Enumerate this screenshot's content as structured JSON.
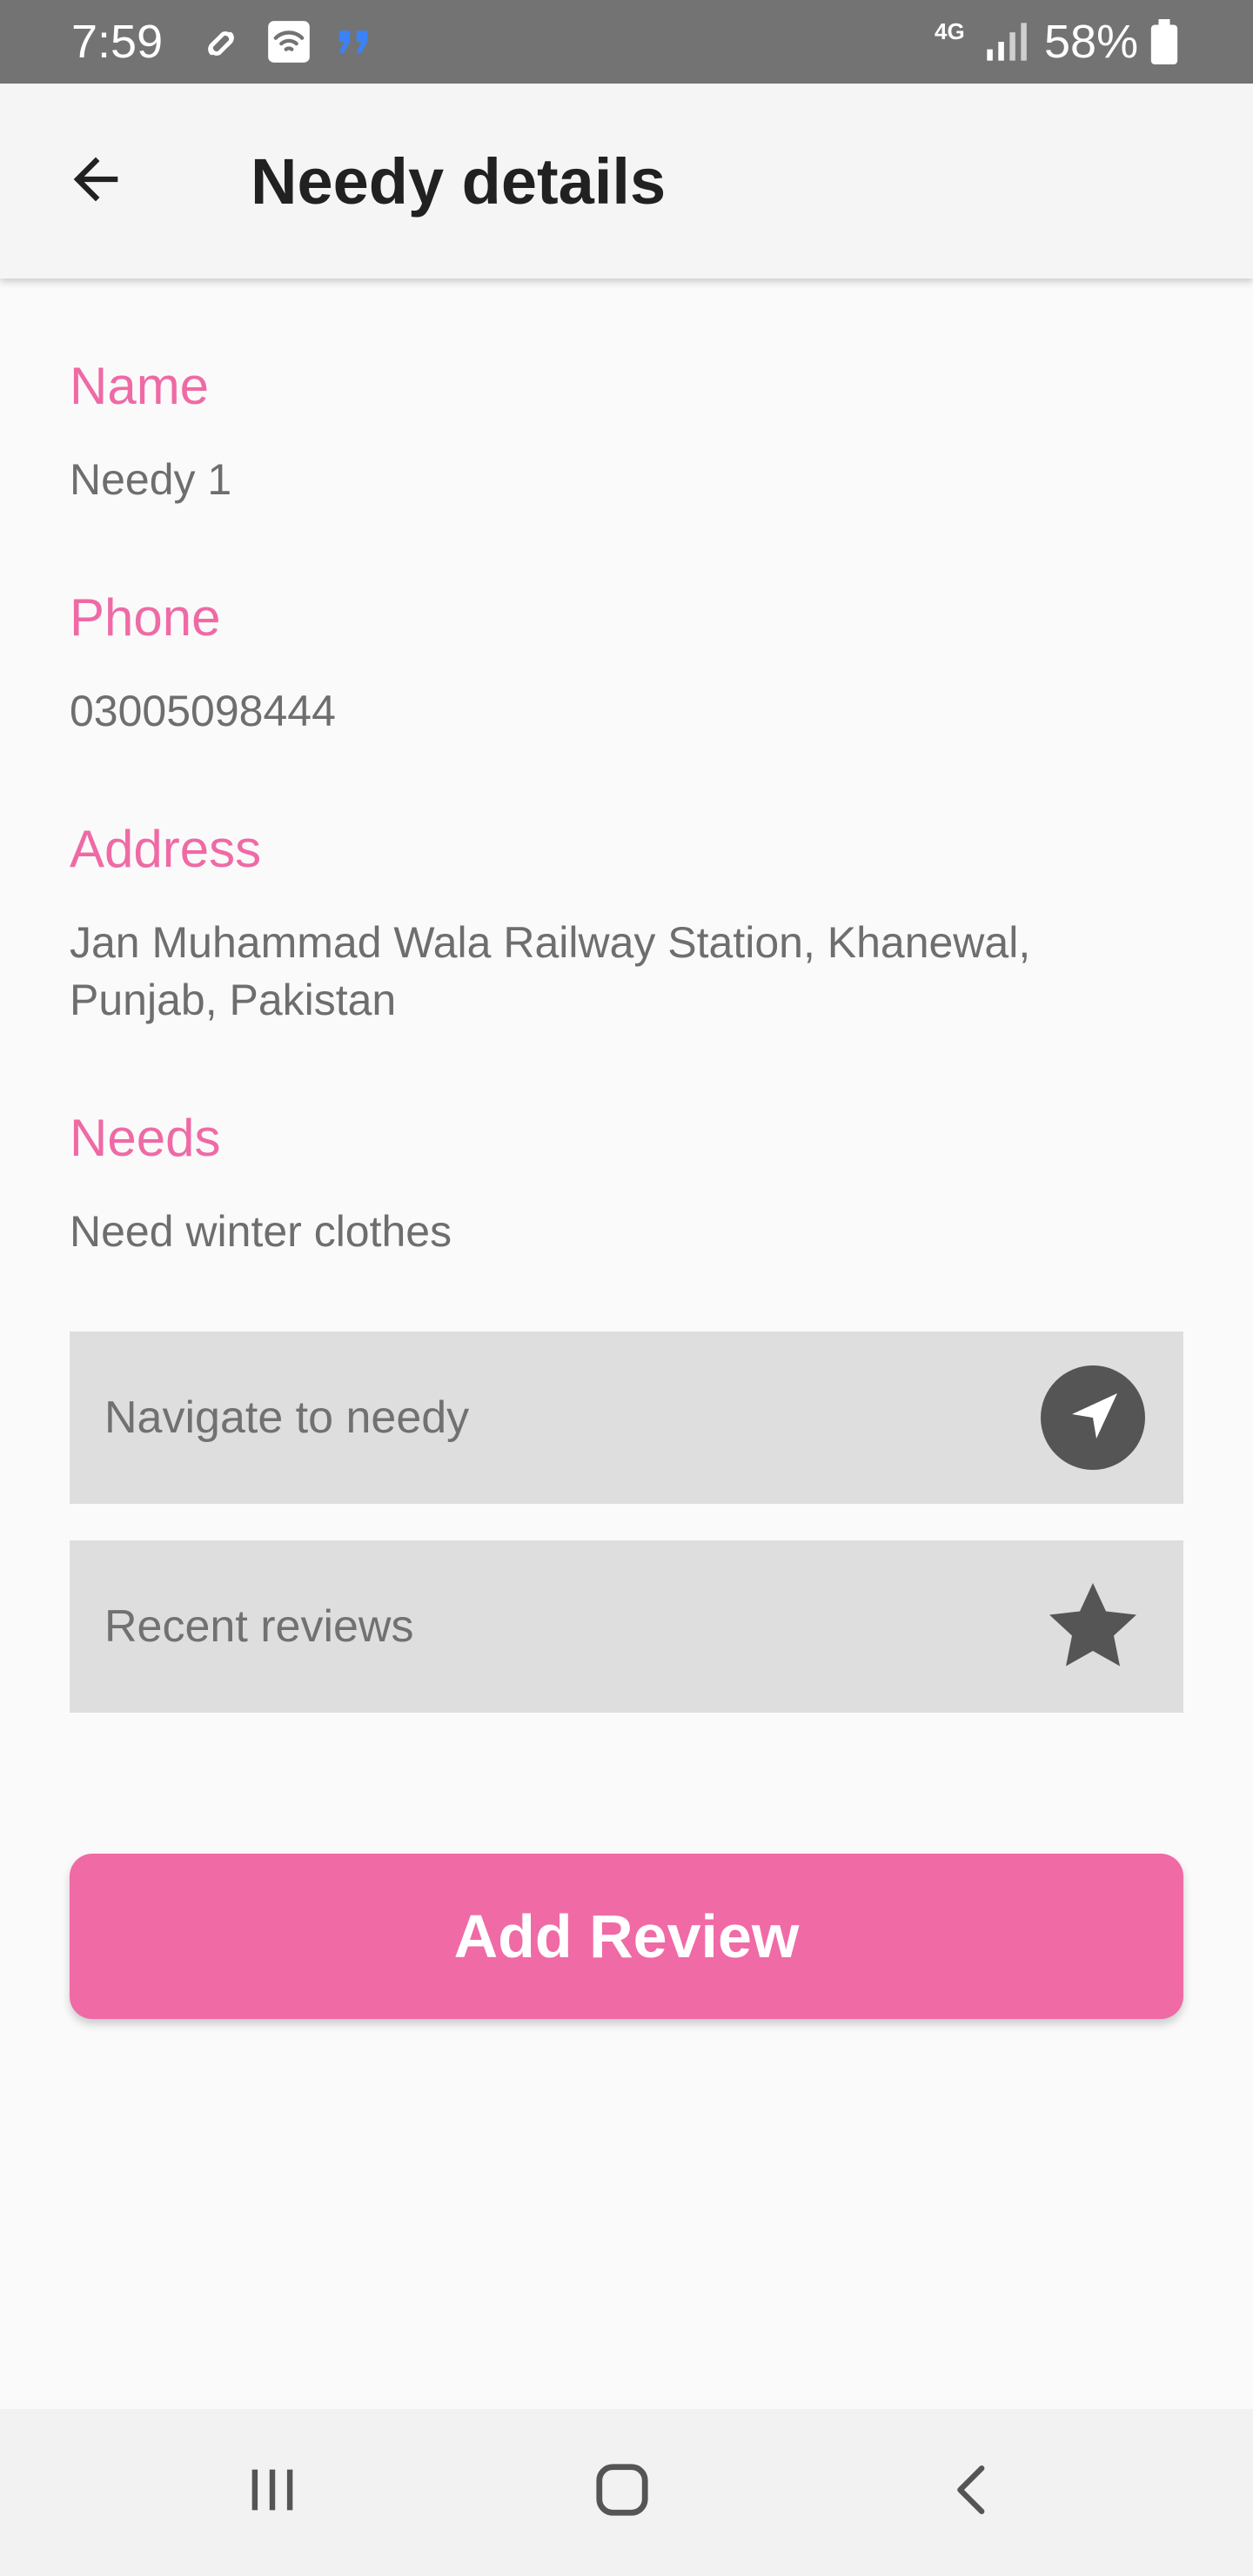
{
  "status_bar": {
    "time": "7:59",
    "battery": "58%",
    "network": "4G",
    "icons": [
      "link-icon",
      "wifi-icon",
      "message-icon",
      "signal-icon",
      "battery-icon"
    ]
  },
  "app_bar": {
    "title": "Needy details",
    "back_icon": "arrow-left-icon"
  },
  "fields": {
    "name": {
      "label": "Name",
      "value": "Needy 1"
    },
    "phone": {
      "label": "Phone",
      "value": "03005098444"
    },
    "address": {
      "label": "Address",
      "value": "Jan Muhammad Wala Railway Station, Khanewal, Punjab, Pakistan"
    },
    "needs": {
      "label": "Needs",
      "value": "Need winter clothes"
    }
  },
  "actions": {
    "navigate": {
      "label": "Navigate to needy",
      "icon": "navigation-icon"
    },
    "reviews": {
      "label": "Recent reviews",
      "icon": "star-icon"
    }
  },
  "add_review_label": "Add Review",
  "nav_bar": {
    "buttons": [
      "recent-apps-icon",
      "home-icon",
      "back-icon"
    ]
  },
  "colors": {
    "accent": "#ef6aa5",
    "button": "#f06aa6",
    "status_bar": "#737373",
    "action_row": "#dedede",
    "icon_dark": "#555555"
  }
}
